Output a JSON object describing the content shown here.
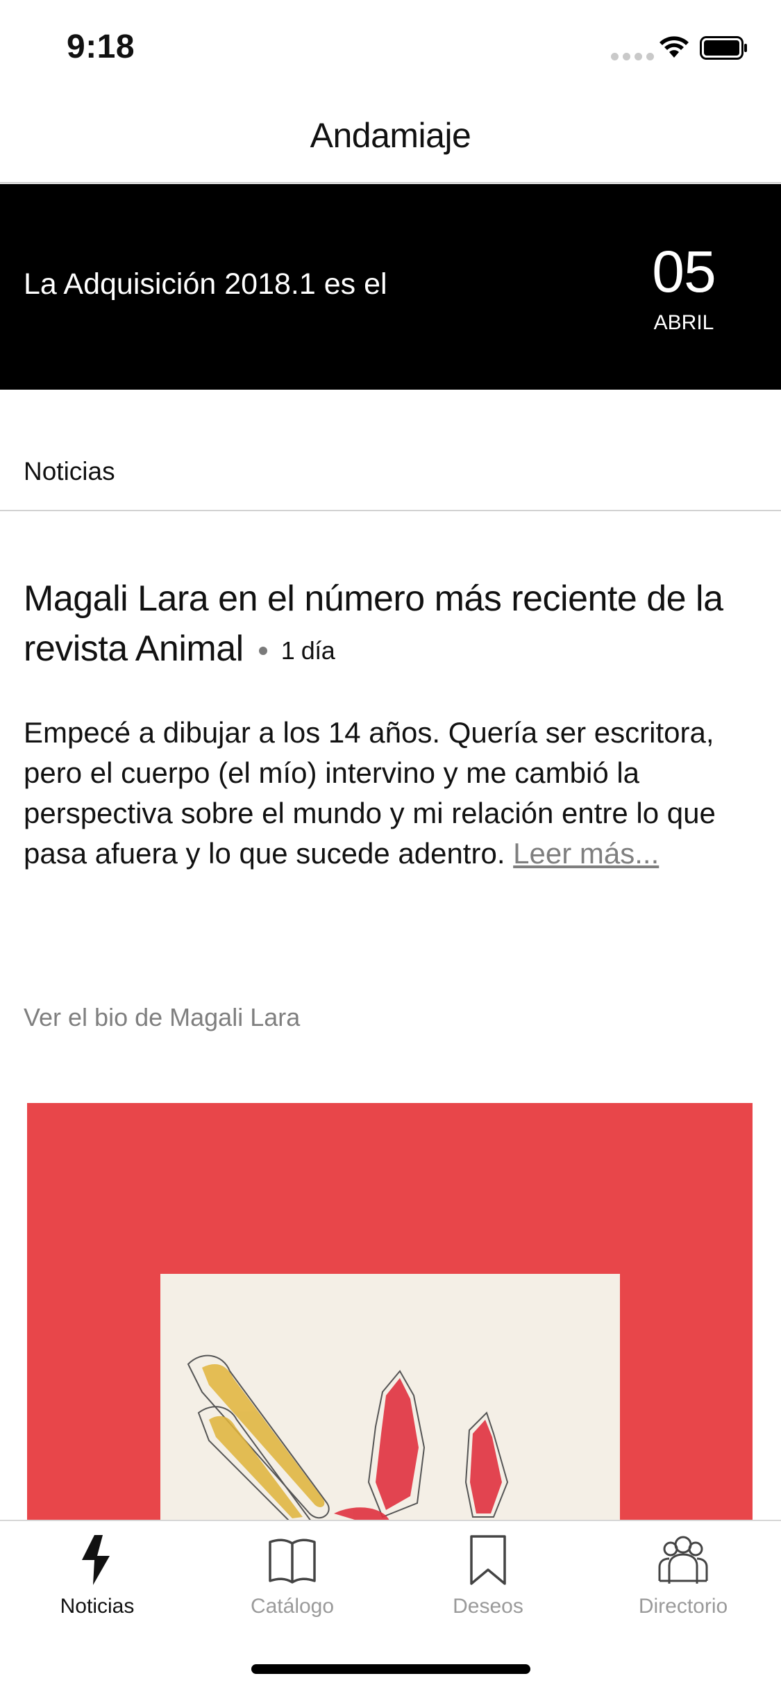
{
  "status_bar": {
    "time": "9:18"
  },
  "nav": {
    "title": "Andamiaje"
  },
  "banner": {
    "text": "La Adquisición 2018.1 es el",
    "day": "05",
    "month": "ABRIL"
  },
  "section": {
    "title": "Noticias"
  },
  "article": {
    "headline": "Magali Lara en el número más reciente de la revista Animal",
    "age": "1 día",
    "body": "Empecé a dibujar a los 14 años. Quería ser escritora, pero el cuerpo (el mío) intervino y me cambió la perspectiva sobre el mundo y mi relación entre lo que pasa afuera y lo que sucede adentro.",
    "read_more": "Leer más...",
    "bio_link": "Ver el bio de Magali Lara",
    "artwork_colors": {
      "background": "#e8464a",
      "paper": "#f4efe6",
      "yellow": "#e0b43a",
      "red": "#e0313f"
    }
  },
  "tabs": [
    {
      "label": "Noticias",
      "icon": "lightning-icon",
      "active": true
    },
    {
      "label": "Catálogo",
      "icon": "book-icon",
      "active": false
    },
    {
      "label": "Deseos",
      "icon": "bookmark-icon",
      "active": false
    },
    {
      "label": "Directorio",
      "icon": "people-icon",
      "active": false
    }
  ]
}
